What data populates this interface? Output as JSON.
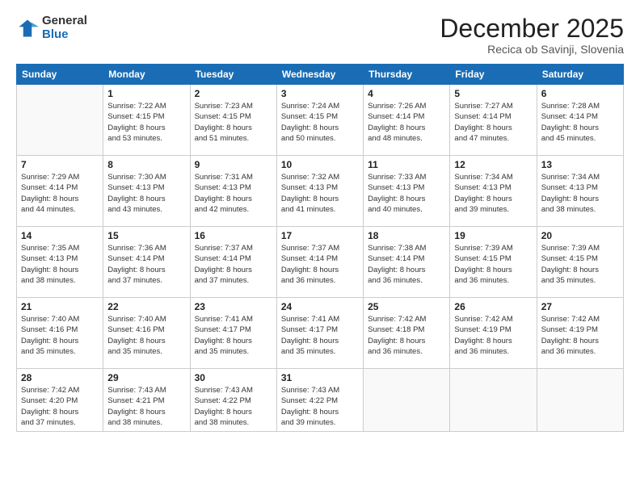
{
  "logo": {
    "general": "General",
    "blue": "Blue"
  },
  "header": {
    "month": "December 2025",
    "location": "Recica ob Savinji, Slovenia"
  },
  "weekdays": [
    "Sunday",
    "Monday",
    "Tuesday",
    "Wednesday",
    "Thursday",
    "Friday",
    "Saturday"
  ],
  "weeks": [
    [
      {
        "day": "",
        "content": ""
      },
      {
        "day": "1",
        "content": "Sunrise: 7:22 AM\nSunset: 4:15 PM\nDaylight: 8 hours\nand 53 minutes."
      },
      {
        "day": "2",
        "content": "Sunrise: 7:23 AM\nSunset: 4:15 PM\nDaylight: 8 hours\nand 51 minutes."
      },
      {
        "day": "3",
        "content": "Sunrise: 7:24 AM\nSunset: 4:15 PM\nDaylight: 8 hours\nand 50 minutes."
      },
      {
        "day": "4",
        "content": "Sunrise: 7:26 AM\nSunset: 4:14 PM\nDaylight: 8 hours\nand 48 minutes."
      },
      {
        "day": "5",
        "content": "Sunrise: 7:27 AM\nSunset: 4:14 PM\nDaylight: 8 hours\nand 47 minutes."
      },
      {
        "day": "6",
        "content": "Sunrise: 7:28 AM\nSunset: 4:14 PM\nDaylight: 8 hours\nand 45 minutes."
      }
    ],
    [
      {
        "day": "7",
        "content": "Sunrise: 7:29 AM\nSunset: 4:14 PM\nDaylight: 8 hours\nand 44 minutes."
      },
      {
        "day": "8",
        "content": "Sunrise: 7:30 AM\nSunset: 4:13 PM\nDaylight: 8 hours\nand 43 minutes."
      },
      {
        "day": "9",
        "content": "Sunrise: 7:31 AM\nSunset: 4:13 PM\nDaylight: 8 hours\nand 42 minutes."
      },
      {
        "day": "10",
        "content": "Sunrise: 7:32 AM\nSunset: 4:13 PM\nDaylight: 8 hours\nand 41 minutes."
      },
      {
        "day": "11",
        "content": "Sunrise: 7:33 AM\nSunset: 4:13 PM\nDaylight: 8 hours\nand 40 minutes."
      },
      {
        "day": "12",
        "content": "Sunrise: 7:34 AM\nSunset: 4:13 PM\nDaylight: 8 hours\nand 39 minutes."
      },
      {
        "day": "13",
        "content": "Sunrise: 7:34 AM\nSunset: 4:13 PM\nDaylight: 8 hours\nand 38 minutes."
      }
    ],
    [
      {
        "day": "14",
        "content": "Sunrise: 7:35 AM\nSunset: 4:13 PM\nDaylight: 8 hours\nand 38 minutes."
      },
      {
        "day": "15",
        "content": "Sunrise: 7:36 AM\nSunset: 4:14 PM\nDaylight: 8 hours\nand 37 minutes."
      },
      {
        "day": "16",
        "content": "Sunrise: 7:37 AM\nSunset: 4:14 PM\nDaylight: 8 hours\nand 37 minutes."
      },
      {
        "day": "17",
        "content": "Sunrise: 7:37 AM\nSunset: 4:14 PM\nDaylight: 8 hours\nand 36 minutes."
      },
      {
        "day": "18",
        "content": "Sunrise: 7:38 AM\nSunset: 4:14 PM\nDaylight: 8 hours\nand 36 minutes."
      },
      {
        "day": "19",
        "content": "Sunrise: 7:39 AM\nSunset: 4:15 PM\nDaylight: 8 hours\nand 36 minutes."
      },
      {
        "day": "20",
        "content": "Sunrise: 7:39 AM\nSunset: 4:15 PM\nDaylight: 8 hours\nand 35 minutes."
      }
    ],
    [
      {
        "day": "21",
        "content": "Sunrise: 7:40 AM\nSunset: 4:16 PM\nDaylight: 8 hours\nand 35 minutes."
      },
      {
        "day": "22",
        "content": "Sunrise: 7:40 AM\nSunset: 4:16 PM\nDaylight: 8 hours\nand 35 minutes."
      },
      {
        "day": "23",
        "content": "Sunrise: 7:41 AM\nSunset: 4:17 PM\nDaylight: 8 hours\nand 35 minutes."
      },
      {
        "day": "24",
        "content": "Sunrise: 7:41 AM\nSunset: 4:17 PM\nDaylight: 8 hours\nand 35 minutes."
      },
      {
        "day": "25",
        "content": "Sunrise: 7:42 AM\nSunset: 4:18 PM\nDaylight: 8 hours\nand 36 minutes."
      },
      {
        "day": "26",
        "content": "Sunrise: 7:42 AM\nSunset: 4:19 PM\nDaylight: 8 hours\nand 36 minutes."
      },
      {
        "day": "27",
        "content": "Sunrise: 7:42 AM\nSunset: 4:19 PM\nDaylight: 8 hours\nand 36 minutes."
      }
    ],
    [
      {
        "day": "28",
        "content": "Sunrise: 7:42 AM\nSunset: 4:20 PM\nDaylight: 8 hours\nand 37 minutes."
      },
      {
        "day": "29",
        "content": "Sunrise: 7:43 AM\nSunset: 4:21 PM\nDaylight: 8 hours\nand 38 minutes."
      },
      {
        "day": "30",
        "content": "Sunrise: 7:43 AM\nSunset: 4:22 PM\nDaylight: 8 hours\nand 38 minutes."
      },
      {
        "day": "31",
        "content": "Sunrise: 7:43 AM\nSunset: 4:22 PM\nDaylight: 8 hours\nand 39 minutes."
      },
      {
        "day": "",
        "content": ""
      },
      {
        "day": "",
        "content": ""
      },
      {
        "day": "",
        "content": ""
      }
    ]
  ]
}
